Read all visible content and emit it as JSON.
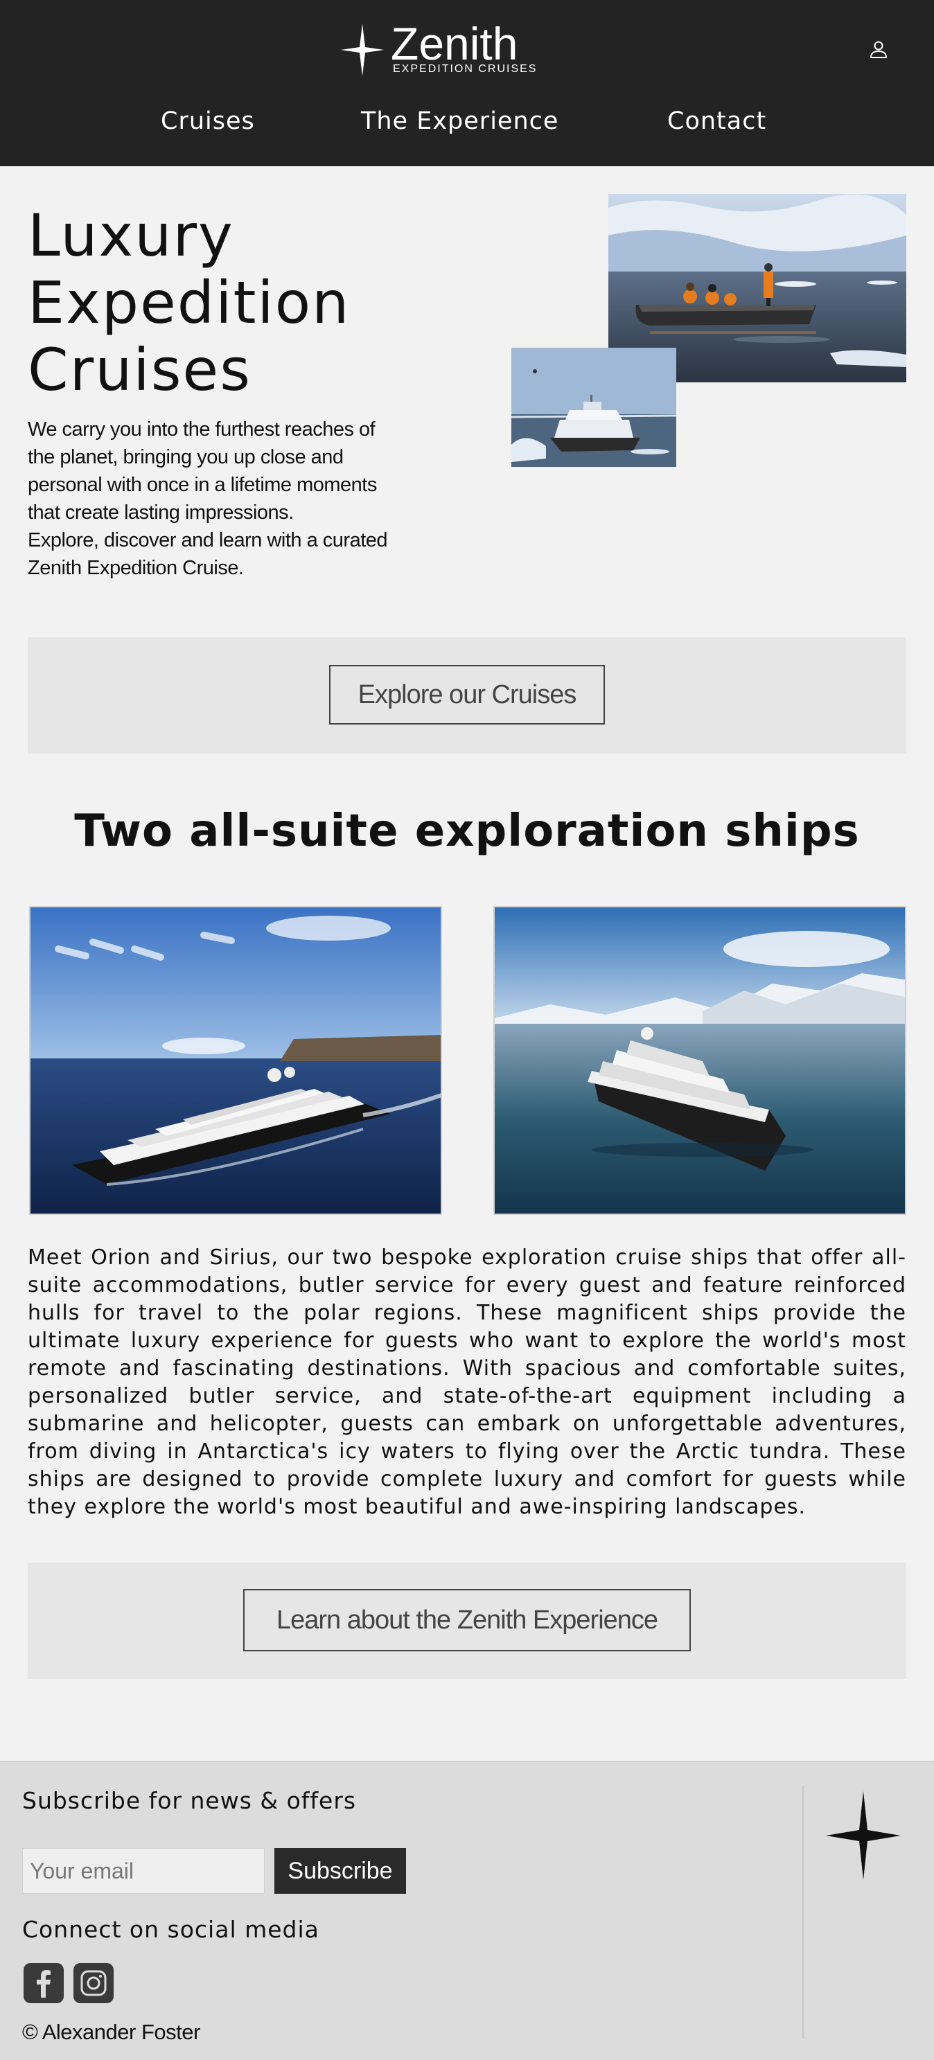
{
  "header": {
    "logo": {
      "name": "Zenith",
      "subtitle": "EXPEDITION CRUISES",
      "icon": "four-point-star-icon"
    },
    "account_icon": "user-icon",
    "nav": [
      {
        "label": "Cruises"
      },
      {
        "label": "The Experience"
      },
      {
        "label": "Contact"
      }
    ],
    "background": "#232323"
  },
  "hero": {
    "title_lines": [
      "Luxury",
      "Expedition",
      "Cruises"
    ],
    "paragraph_lines": [
      "We carry you into the furthest reaches of",
      "the planet, bringing you up close and",
      "personal with once in a lifetime moments",
      "that create lasting impressions.",
      "Explore, discover and learn with a curated",
      "Zenith Expedition Cruise."
    ],
    "cta_label": "Explore our Cruises"
  },
  "ships": {
    "title": "Two all-suite exploration ships",
    "description": "Meet Orion and Sirius, our two bespoke exploration cruise ships that offer all-suite accommodations, butler service for every guest and feature reinforced hulls for travel to the polar regions. These magnificent ships provide the ultimate luxury experience for guests who want to explore the world's most remote and fascinating destinations. With spacious and comfortable suites, personalized butler service, and state-of-the-art equipment including a submarine and helicopter, guests can embark on unforgettable adventures, from diving in Antarctica's icy waters to flying over the Arctic tundra. These ships are designed to provide complete luxury and comfort for guests while they explore the world's most beautiful and awe-inspiring landscapes.",
    "cta_label": "Learn about the Zenith Experience"
  },
  "footer": {
    "subscribe_heading": "Subscribe for news & offers",
    "email_placeholder": "Your email",
    "subscribe_label": "Subscribe",
    "social_heading": "Connect on social media",
    "social_icons": [
      "facebook-icon",
      "instagram-icon"
    ],
    "copyright": "© Alexander Foster",
    "background": "#dcdcdc"
  },
  "colors": {
    "page_bg": "#f2f2f2",
    "panel_bg": "#e6e6e6",
    "button_dark": "#2a2a2a"
  }
}
